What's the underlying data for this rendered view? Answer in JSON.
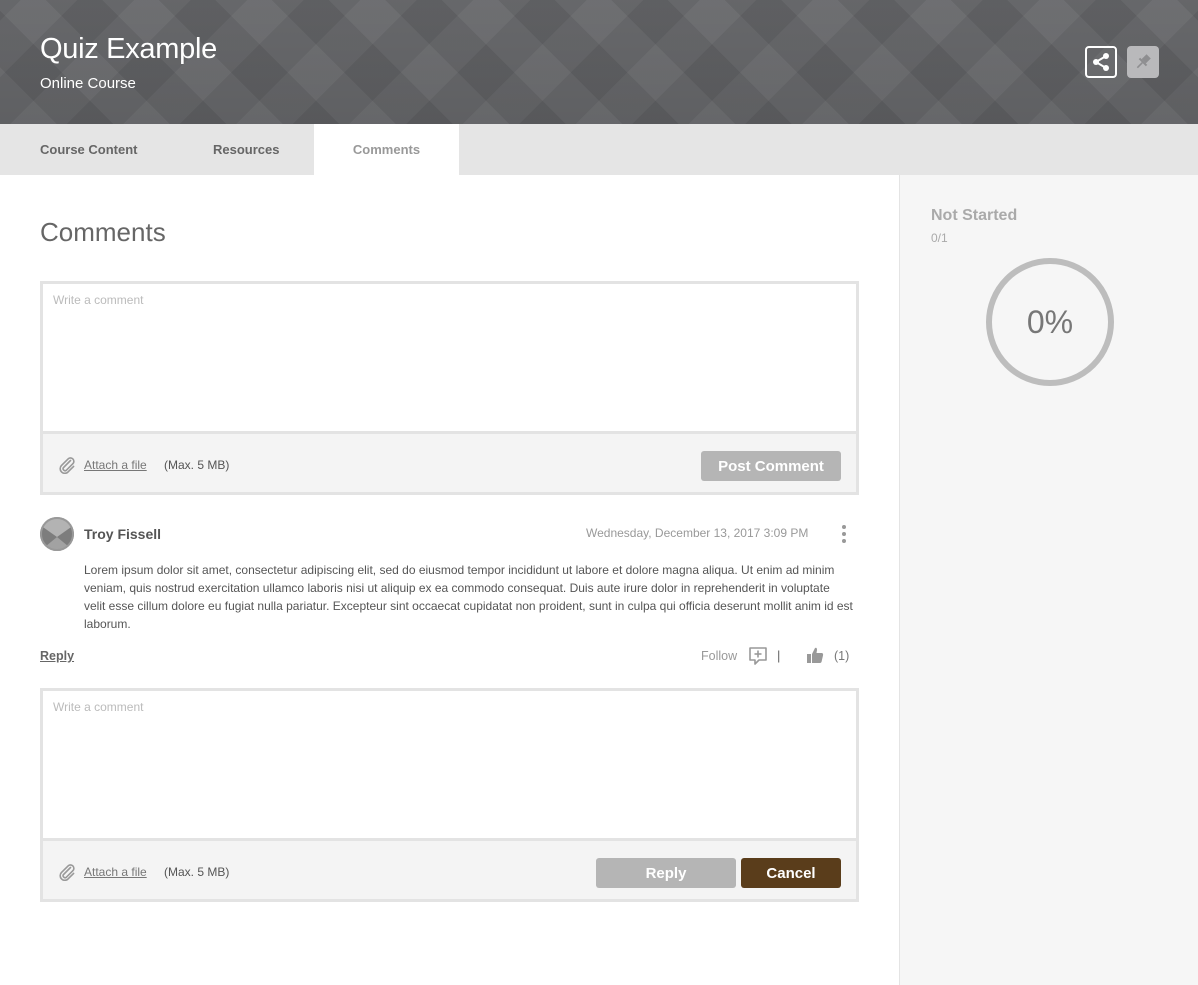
{
  "header": {
    "title": "Quiz Example",
    "subtitle": "Online Course",
    "share_icon": "share-icon",
    "pin_icon": "pin-icon"
  },
  "tabs": [
    {
      "label": "Course Content",
      "active": false
    },
    {
      "label": "Resources",
      "active": false
    },
    {
      "label": "Comments",
      "active": true
    }
  ],
  "main": {
    "title": "Comments",
    "composer": {
      "placeholder": "Write a comment",
      "attach_label": "Attach a file",
      "max_size": "(Max. 5 MB)",
      "post_label": "Post Comment"
    },
    "comment": {
      "author": "Troy Fissell",
      "timestamp": "Wednesday, December 13, 2017 3:09 PM",
      "body": "Lorem ipsum dolor sit amet, consectetur adipiscing elit, sed do eiusmod tempor incididunt ut labore et dolore magna aliqua. Ut enim ad minim veniam, quis nostrud exercitation ullamco laboris nisi ut aliquip ex ea commodo consequat. Duis aute irure dolor in reprehenderit in voluptate velit esse cillum dolore eu fugiat nulla pariatur. Excepteur sint occaecat cupidatat non proident, sunt in culpa qui officia deserunt mollit anim id est laborum.",
      "reply_link": "Reply",
      "follow_label": "Follow",
      "separator": "|",
      "like_count": "(1)"
    },
    "reply_composer": {
      "placeholder": "Write a comment",
      "attach_label": "Attach a file",
      "max_size": "(Max. 5 MB)",
      "reply_label": "Reply",
      "cancel_label": "Cancel"
    }
  },
  "sidebar": {
    "status": "Not Started",
    "count": "0/1",
    "progress_percent": 0,
    "progress_label": "0%"
  },
  "colors": {
    "accent_brown": "#5a3d1b",
    "button_grey": "#b5b5b5",
    "header_grey": "#6a6b6e"
  }
}
